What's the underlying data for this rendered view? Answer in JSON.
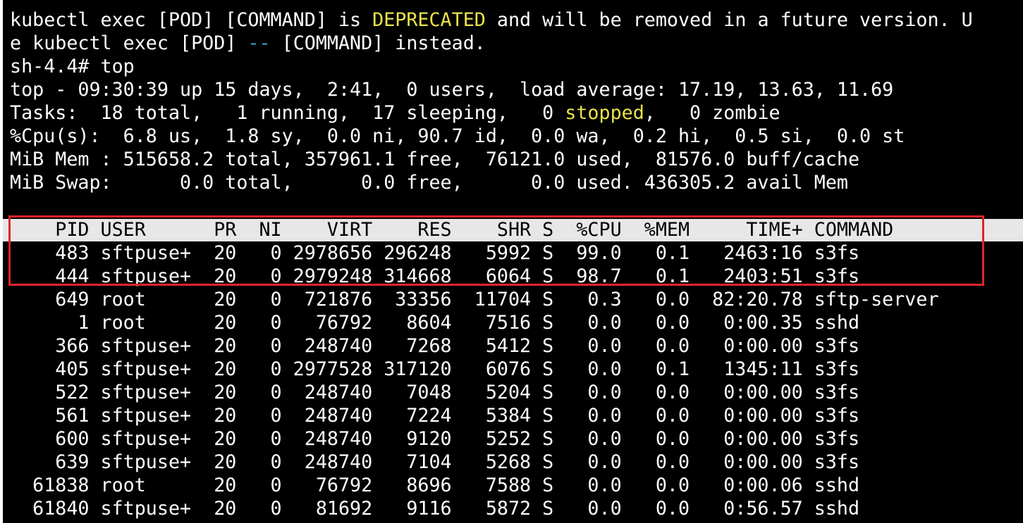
{
  "terminal": {
    "warning": {
      "prefix": "kubectl exec [POD] [COMMAND] is ",
      "highlight": "DEPRECATED",
      "suffix": " and will be removed in a future version. U"
    },
    "warning_cont": {
      "prefix": "e kubectl exec [POD] ",
      "dashes": "--",
      "suffix": " [COMMAND] instead."
    },
    "prompt": "sh-4.4# top",
    "summary_top": "top - 09:30:39 up 15 days,  2:41,  0 users,  load average: 17.19, 13.63, 11.69",
    "summary_tasks": {
      "prefix": "Tasks:  18 total,   1 running,  17 sleeping,   0 ",
      "stopped": "stopped",
      "suffix": ",   0 zombie"
    },
    "summary_cpu": "%Cpu(s):  6.8 us,  1.8 sy,  0.0 ni, 90.7 id,  0.0 wa,  0.2 hi,  0.5 si,  0.0 st",
    "summary_mem": "MiB Mem : 515658.2 total, 357961.1 free,  76121.0 used,  81576.0 buff/cache",
    "summary_swap": "MiB Swap:      0.0 total,      0.0 free,      0.0 used. 436305.2 avail Mem",
    "process_header": "    PID USER      PR  NI    VIRT    RES    SHR S  %CPU  %MEM     TIME+ COMMAND",
    "processes": [
      "    483 sftpuse+  20   0 2978656 296248   5992 S  99.0   0.1   2463:16 s3fs",
      "    444 sftpuse+  20   0 2979248 314668   6064 S  98.7   0.1   2403:51 s3fs",
      "    649 root      20   0  721876  33356  11704 S   0.3   0.0  82:20.78 sftp-server",
      "      1 root      20   0   76792   8604   7516 S   0.0   0.0   0:00.35 sshd",
      "    366 sftpuse+  20   0  248740   7268   5412 S   0.0   0.0   0:00.00 s3fs",
      "    405 sftpuse+  20   0 2977528 317120   6076 S   0.0   0.1   1345:11 s3fs",
      "    522 sftpuse+  20   0  248740   7048   5204 S   0.0   0.0   0:00.00 s3fs",
      "    561 sftpuse+  20   0  248740   7224   5384 S   0.0   0.0   0:00.00 s3fs",
      "    600 sftpuse+  20   0  248740   9120   5252 S   0.0   0.0   0:00.00 s3fs",
      "    639 sftpuse+  20   0  248740   7104   5268 S   0.0   0.0   0:00.00 s3fs",
      "  61838 root      20   0   76792   8696   7588 S   0.0   0.0   0:00.06 sshd",
      "  61840 sftpuse+  20   0   81692   9116   5872 S   0.0   0.0   0:56.57 sshd"
    ]
  },
  "colors": {
    "background": "#000000",
    "foreground": "#ffffff",
    "warning_yellow": "#e8e24c",
    "dash_cyan": "#3a9fd6",
    "header_bar": "#e7e7e7",
    "highlight_box": "#e0242a"
  }
}
